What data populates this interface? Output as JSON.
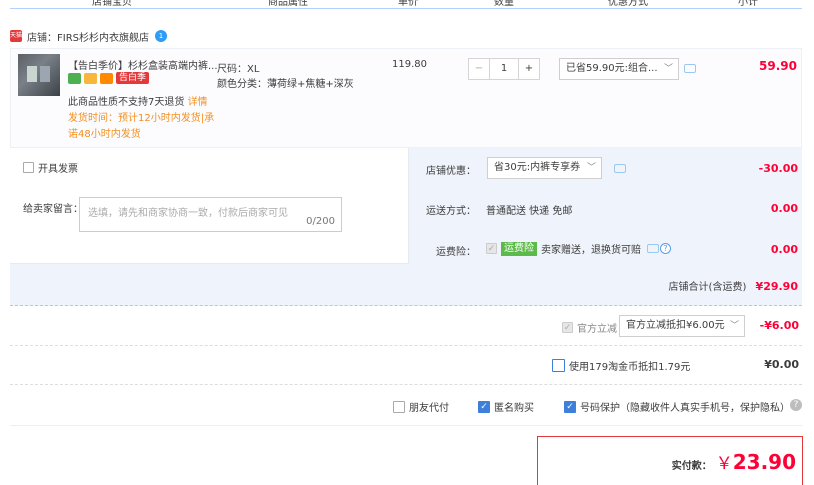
{
  "header": {
    "cols": [
      "店铺宝贝",
      "商品属性",
      "单价",
      "数量",
      "优惠方式",
      "小计"
    ]
  },
  "shop": {
    "badge": "天猫",
    "name": "店铺：FIRS杉杉内衣旗舰店",
    "ww": "1"
  },
  "item": {
    "title": "【告白季价】杉杉盒装高端内裤...",
    "promo_tag": "告白季",
    "size": "尺码：XL",
    "color": "颜色分类：薄荷绿+焦糖+深灰",
    "price": "119.80",
    "qty": "1",
    "minus": "−",
    "plus": "+",
    "discount_select": "已省59.90元:组合...",
    "subtotal": "59.90",
    "no_return": "此商品性质不支持7天退货",
    "detail_link": "详情",
    "ship_line1": "发货时间：预计12小时内发货|承",
    "ship_line2": "诺48小时内发货"
  },
  "options": {
    "invoice": "开具发票",
    "message_label": "给卖家留言：",
    "message_placeholder": "选填，请先和商家协商一致，付款后商家可见",
    "message_count": "0/200",
    "shop_discount_label": "店铺优惠：",
    "shop_discount_select": "省30元:内裤专享券",
    "shop_discount_value": "-30.00",
    "delivery_label": "运送方式：",
    "delivery_value": "普通配送 快递 免邮",
    "delivery_price": "0.00",
    "insurance_label": "运费险：",
    "insurance_tag": "运费险",
    "insurance_text": "卖家赠送，退换货可赔",
    "insurance_price": "0.00",
    "shop_total_label": "店铺合计(含运费)",
    "shop_total": "¥29.90"
  },
  "official": {
    "label": "官方立减",
    "select": "官方立减抵扣¥6.00元",
    "value": "-¥6.00"
  },
  "coins": {
    "label": "使用179淘金币抵扣1.79元",
    "value": "¥0.00"
  },
  "extras": {
    "friend_pay": "朋友代付",
    "anonymous": "匿名购买",
    "privacy": "号码保护（隐藏收件人真实手机号，保护隐私）"
  },
  "pay": {
    "label": "实付款：",
    "currency": "￥",
    "amount": "23.90"
  },
  "colors": {
    "accent_red": "#ff0036",
    "orange": "#f38f1f",
    "blue": "#3d7fd9",
    "panel": "#eff3fb"
  }
}
